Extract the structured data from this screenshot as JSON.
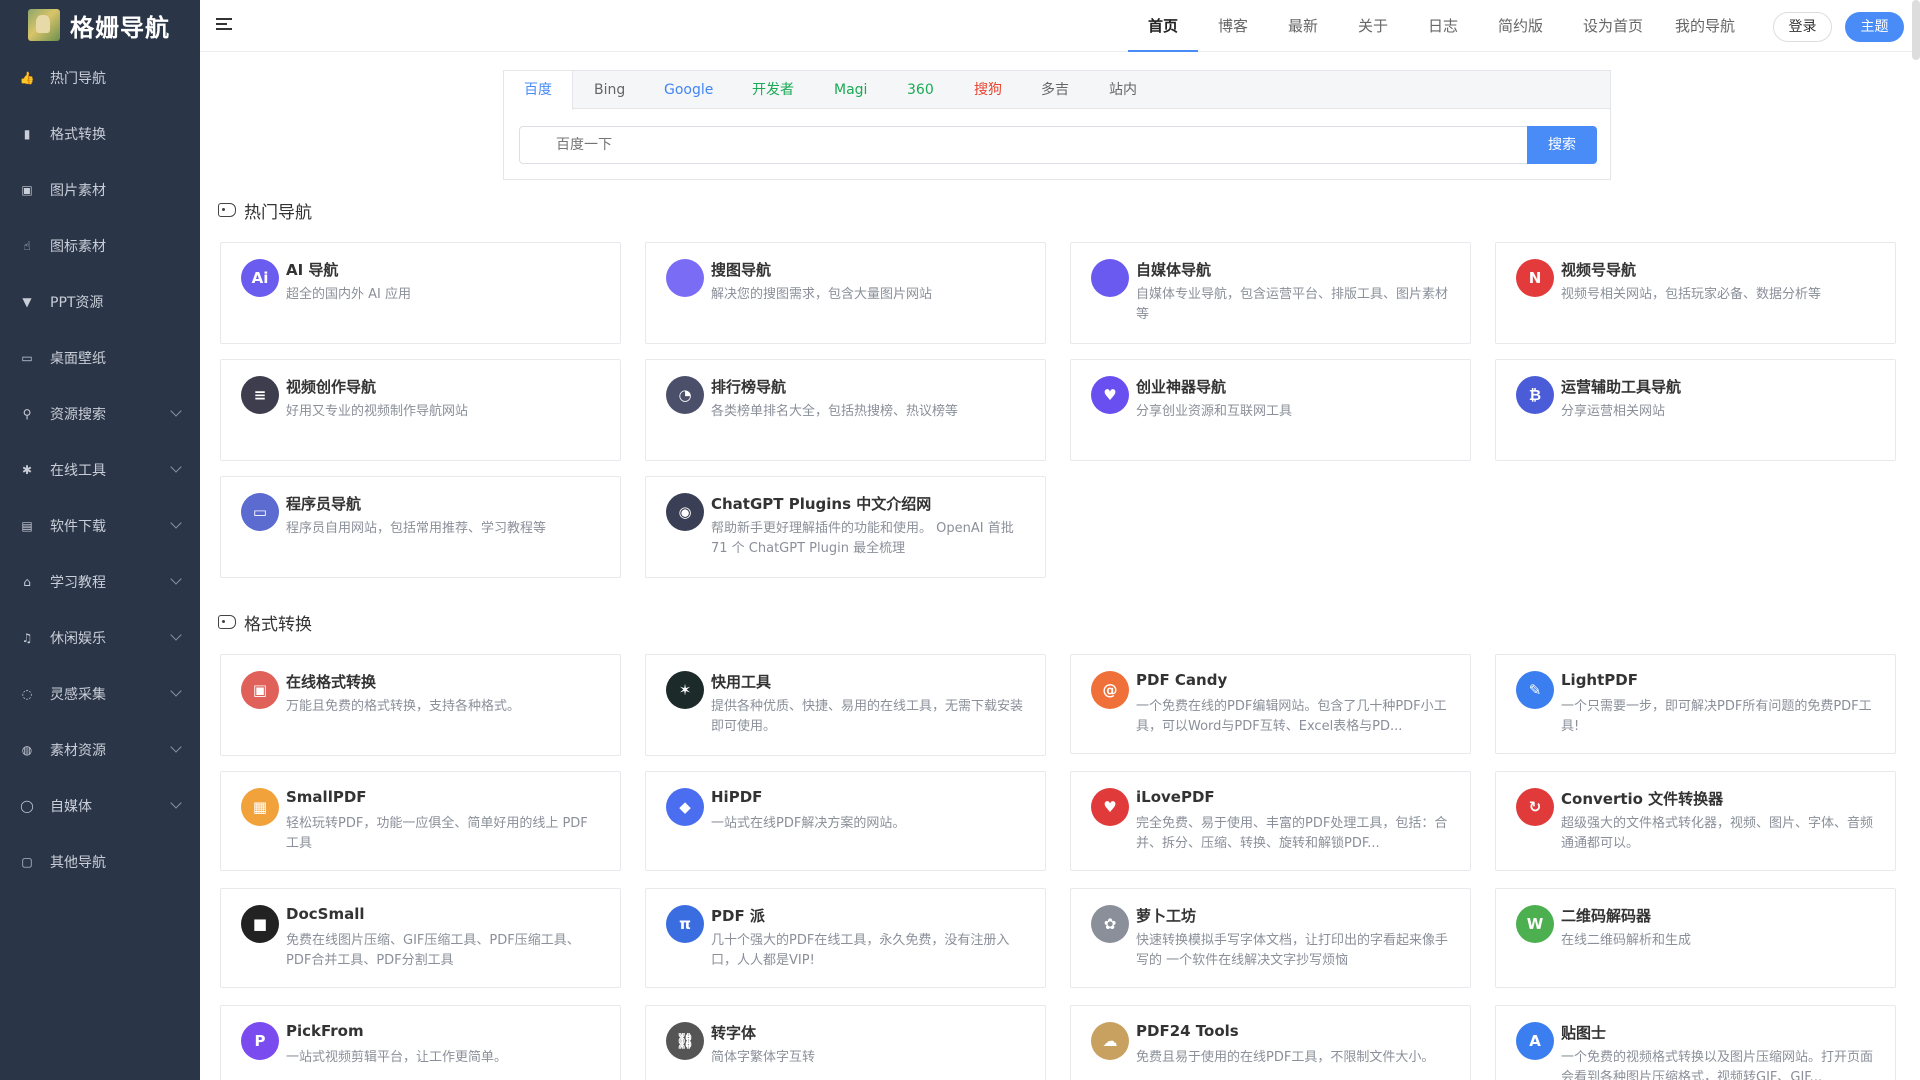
{
  "brand": {
    "name": "格姗导航"
  },
  "sidebar": {
    "items": [
      {
        "label": "热门导航",
        "icon": "thumb-icon",
        "expandable": false
      },
      {
        "label": "格式转换",
        "icon": "bag-icon",
        "expandable": false
      },
      {
        "label": "图片素材",
        "icon": "image-icon",
        "expandable": false
      },
      {
        "label": "图标素材",
        "icon": "hand-icon",
        "expandable": false
      },
      {
        "label": "PPT资源",
        "icon": "shirt-icon",
        "expandable": false
      },
      {
        "label": "桌面壁纸",
        "icon": "monitor-icon",
        "expandable": false
      },
      {
        "label": "资源搜索",
        "icon": "search-icon",
        "expandable": true
      },
      {
        "label": "在线工具",
        "icon": "tools-icon",
        "expandable": true
      },
      {
        "label": "软件下载",
        "icon": "calendar-icon",
        "expandable": true
      },
      {
        "label": "学习教程",
        "icon": "cap-icon",
        "expandable": true
      },
      {
        "label": "休闲娱乐",
        "icon": "music-icon",
        "expandable": true
      },
      {
        "label": "灵感采集",
        "icon": "bulb-icon",
        "expandable": true
      },
      {
        "label": "素材资源",
        "icon": "globe-icon",
        "expandable": true
      },
      {
        "label": "自媒体",
        "icon": "circle-icon",
        "expandable": true
      },
      {
        "label": "其他导航",
        "icon": "frame-icon",
        "expandable": false
      }
    ]
  },
  "header": {
    "tabs": [
      {
        "label": "首页",
        "active": true
      },
      {
        "label": "博客"
      },
      {
        "label": "最新"
      },
      {
        "label": "关于"
      },
      {
        "label": "日志"
      },
      {
        "label": "简约版"
      },
      {
        "label": "设为首页"
      },
      {
        "label": "我的导航"
      }
    ],
    "login": "登录",
    "theme": "主题"
  },
  "search": {
    "engines": [
      {
        "label": "百度",
        "color": "#4a8cf7",
        "active": true
      },
      {
        "label": "Bing",
        "color": "#666666"
      },
      {
        "label": "Google",
        "color": "#4285f4"
      },
      {
        "label": "开发者",
        "color": "#1aaa55"
      },
      {
        "label": "Magi",
        "color": "#1aaa55"
      },
      {
        "label": "360",
        "color": "#1aaa55"
      },
      {
        "label": "搜狗",
        "color": "#e8442e"
      },
      {
        "label": "多吉",
        "color": "#666666"
      },
      {
        "label": "站内",
        "color": "#666666"
      }
    ],
    "placeholder": "百度一下",
    "button": "搜索"
  },
  "sections": [
    {
      "title": "热门导航",
      "cards": [
        {
          "title": "AI 导航",
          "desc": "超全的国内外 AI 应用",
          "icon": "ai-icon",
          "color": "#6b5cf0",
          "glyph": "Ai"
        },
        {
          "title": "搜图导航",
          "desc": "解决您的搜图需求，包含大量图片网站",
          "icon": "balloon-icon",
          "color": "#7b6cf6",
          "glyph": ""
        },
        {
          "title": "自媒体导航",
          "desc": "自媒体专业导航，包含运营平台、排版工具、图片素材等",
          "icon": "media-icon",
          "color": "#6a5af0",
          "glyph": ""
        },
        {
          "title": "视频号导航",
          "desc": "视频号相关网站，包括玩家必备、数据分析等",
          "icon": "netflix-icon",
          "color": "#e33b3b",
          "glyph": "N"
        },
        {
          "title": "视频创作导航",
          "desc": "好用又专业的视频制作导航网站",
          "icon": "layers-icon",
          "color": "#3d3d4e",
          "glyph": "≡"
        },
        {
          "title": "排行榜导航",
          "desc": "各类榜单排名大全，包括热搜榜、热议榜等",
          "icon": "pie-icon",
          "color": "#4b4f6a",
          "glyph": "◔"
        },
        {
          "title": "创业神器导航",
          "desc": "分享创业资源和互联网工具",
          "icon": "heart-icon",
          "color": "#6a4ff0",
          "glyph": "♥"
        },
        {
          "title": "运营辅助工具导航",
          "desc": "分享运营相关网站",
          "icon": "bitcoin-icon",
          "color": "#4b5cd8",
          "glyph": "₿"
        },
        {
          "title": "程序员导航",
          "desc": "程序员自用网站，包括常用推荐、学习教程等",
          "icon": "monitor-icon",
          "color": "#5b6bd0",
          "glyph": "▭"
        },
        {
          "title": "ChatGPT Plugins 中文介绍网",
          "desc": "帮助新手更好理解插件的功能和使用。 OpenAI 首批 71 个 ChatGPT Plugin 最全梳理",
          "icon": "robot-icon",
          "color": "#3a3f55",
          "glyph": "◉"
        }
      ]
    },
    {
      "title": "格式转换",
      "cards": [
        {
          "title": "在线格式转换",
          "desc": "万能且免费的格式转换，支持各种格式。",
          "icon": "cube-icon",
          "color": "#e0605a",
          "glyph": "▣"
        },
        {
          "title": "快用工具",
          "desc": "提供各种优质、快捷、易用的在线工具，无需下载安装即可使用。",
          "icon": "star-icon",
          "color": "#1d2a2a",
          "glyph": "✶"
        },
        {
          "title": "PDF Candy",
          "desc": "一个免费在线的PDF编辑网站。包含了几十种PDF小工具，可以Word与PDF互转、Excel表格与PD...",
          "icon": "spiral-icon",
          "color": "#f0703a",
          "glyph": "@"
        },
        {
          "title": "LightPDF",
          "desc": "一个只需要一步，即可解决PDF所有问题的免费PDF工具!",
          "icon": "feather-icon",
          "color": "#3a7ef0",
          "glyph": "✎"
        },
        {
          "title": "SmallPDF",
          "desc": "轻松玩转PDF，功能一应俱全、简单好用的线上 PDF 工具",
          "icon": "grid-icon",
          "color": "#f2a23a",
          "glyph": "▦"
        },
        {
          "title": "HiPDF",
          "desc": "一站式在线PDF解决方案的网站。",
          "icon": "hipdf-icon",
          "color": "#4b6ef0",
          "glyph": "◆"
        },
        {
          "title": "iLovePDF",
          "desc": "完全免费、易于使用、丰富的PDF处理工具，包括：合并、拆分、压缩、转换、旋转和解锁PDF...",
          "icon": "heart-red-icon",
          "color": "#e03a3a",
          "glyph": "♥"
        },
        {
          "title": "Convertio 文件转换器",
          "desc": "超级强大的文件格式转化器，视频、图片、字体、音频通通都可以。",
          "icon": "refresh-icon",
          "color": "#e03a3a",
          "glyph": "↻"
        },
        {
          "title": "DocSmall",
          "desc": "免费在线图片压缩、GIF压缩工具、PDF压缩工具、PDF合并工具、PDF分割工具",
          "icon": "square-icon",
          "color": "#222222",
          "glyph": "■"
        },
        {
          "title": "PDF 派",
          "desc": "几十个强大的PDF在线工具，永久免费，没有注册入口，人人都是VIP!",
          "icon": "pdf-pai-icon",
          "color": "#3a6ee0",
          "glyph": "π"
        },
        {
          "title": "萝卜工坊",
          "desc": "快速转换模拟手写字体文档，让打印出的字看起来像手写的 一个软件在线解决文字抄写烦恼",
          "icon": "radish-icon",
          "color": "#8a8f99",
          "glyph": "✿"
        },
        {
          "title": "二维码解码器",
          "desc": "在线二维码解析和生成",
          "icon": "w-icon",
          "color": "#4caf50",
          "glyph": "W"
        },
        {
          "title": "PickFrom",
          "desc": "一站式视频剪辑平台，让工作更简单。",
          "icon": "p-icon",
          "color": "#7a4cf0",
          "glyph": "P"
        },
        {
          "title": "转字体",
          "desc": "简体字繁体字互转",
          "icon": "chain-icon",
          "color": "#555555",
          "glyph": "⛓"
        },
        {
          "title": "PDF24 Tools",
          "desc": "免费且易于使用的在线PDF工具，不限制文件大小。",
          "icon": "sheep-icon",
          "color": "#c8a060",
          "glyph": "☁"
        },
        {
          "title": "贴图士",
          "desc": "一个免费的视频格式转换以及图片压缩网站。打开页面会看到各种图片压缩格式，视频转GIF、GIF...",
          "icon": "a-icon",
          "color": "#3a7ef0",
          "glyph": "A"
        }
      ]
    }
  ]
}
